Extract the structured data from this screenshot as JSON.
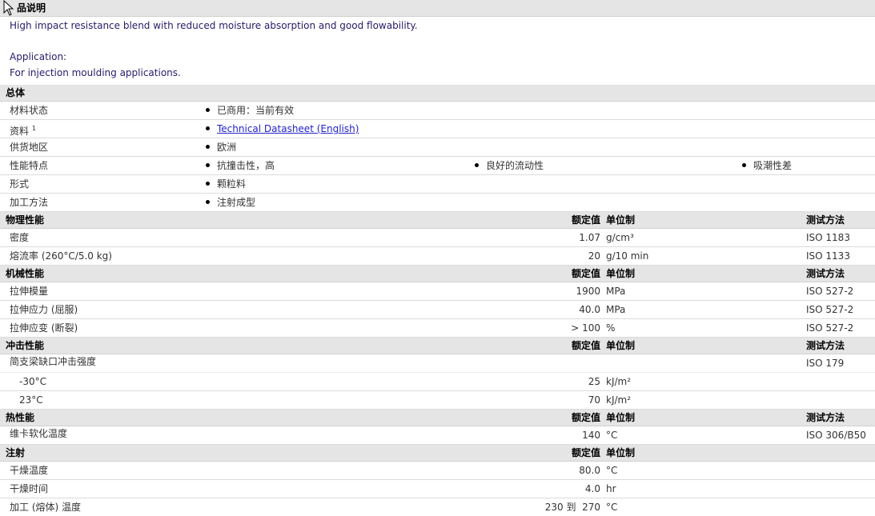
{
  "description": {
    "header": "品说明",
    "line1": "High impact resistance blend with reduced moisture absorption and good flowability.",
    "line2": "Application:",
    "line3": "For injection moulding applications."
  },
  "general": {
    "header": "总体",
    "rows": [
      {
        "label": "材料状态",
        "items": [
          "已商用：当前有效"
        ]
      },
      {
        "label": "资料",
        "sup": "1",
        "link": "Technical Datasheet (English)"
      },
      {
        "label": "供货地区",
        "items": [
          "欧洲"
        ]
      },
      {
        "label": "性能特点",
        "items": [
          "抗撞击性，高",
          "良好的流动性",
          "吸潮性差"
        ]
      },
      {
        "label": "形式",
        "items": [
          "颗粒料"
        ]
      },
      {
        "label": "加工方法",
        "items": [
          "注射成型"
        ]
      }
    ]
  },
  "columns": {
    "value": "额定值",
    "unit": "单位制",
    "method": "测试方法"
  },
  "physical": {
    "header": "物理性能",
    "rows": [
      {
        "label": "密度",
        "value": "1.07",
        "unit": "g/cm³",
        "method": "ISO 1183"
      },
      {
        "label": "熔流率 (260°C/5.0 kg)",
        "value": "20",
        "unit": "g/10 min",
        "method": "ISO 1133"
      }
    ]
  },
  "mechanical": {
    "header": "机械性能",
    "rows": [
      {
        "label": "拉伸模量",
        "value": "1900",
        "unit": "MPa",
        "method": "ISO 527-2"
      },
      {
        "label": "拉伸应力 (屈服)",
        "value": "40.0",
        "unit": "MPa",
        "method": "ISO 527-2"
      },
      {
        "label": "拉伸应变 (断裂)",
        "value": "> 100",
        "unit": "%",
        "method": "ISO 527-2"
      }
    ]
  },
  "impact": {
    "header": "冲击性能",
    "rows": [
      {
        "label": "简支梁缺口冲击强度",
        "value": "",
        "unit": "",
        "method": "ISO 179"
      },
      {
        "label": "-30°C",
        "value": "25",
        "unit": "kJ/m²",
        "method": ""
      },
      {
        "label": "23°C",
        "value": "70",
        "unit": "kJ/m²",
        "method": ""
      }
    ]
  },
  "thermal": {
    "header": "热性能",
    "rows": [
      {
        "label": "维卡软化温度",
        "value": "140",
        "unit": "°C",
        "method": "ISO 306/B50"
      }
    ]
  },
  "injection": {
    "header": "注射",
    "rows": [
      {
        "label": "干燥温度",
        "value": "80.0",
        "unit": "°C"
      },
      {
        "label": "干燥时间",
        "value": "4.0",
        "unit": "hr"
      },
      {
        "label": "加工 (熔体) 温度",
        "value": "230 到  270",
        "unit": "°C"
      }
    ]
  }
}
